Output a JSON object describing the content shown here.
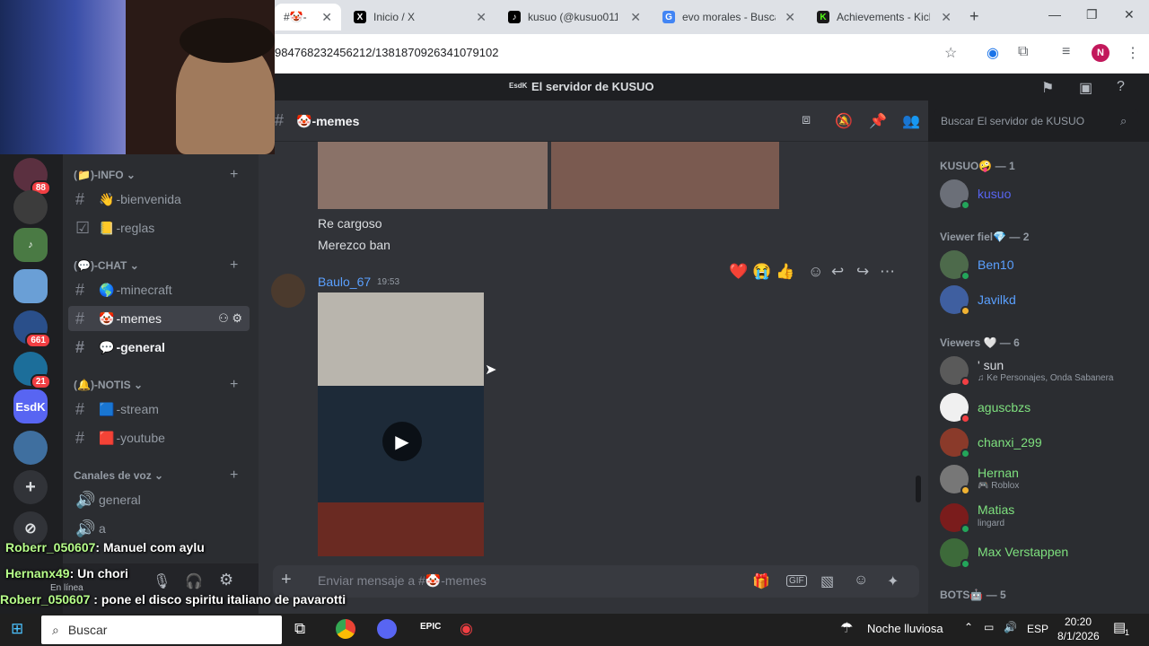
{
  "browser": {
    "tabs": [
      {
        "title": "#🤡-",
        "active": true
      },
      {
        "title": "Inicio / X"
      },
      {
        "title": "kusuo (@kusuo011) |"
      },
      {
        "title": "evo morales - Buscar"
      },
      {
        "title": "Achievements - Kick"
      }
    ],
    "new_tab": "+",
    "url": "984768232456212/1381870926341079102",
    "profile_initial": "N"
  },
  "discord": {
    "server_title": "El servidor de KUSUO",
    "server_abbrev": "EsdK",
    "rail": {
      "badges": [
        "88",
        "661",
        "21"
      ],
      "selected_server": "EsdK"
    },
    "categories": [
      {
        "label": "(📁)-INFO",
        "channels": [
          {
            "emoji": "👋",
            "name": "-bienvenida"
          },
          {
            "emoji": "📒",
            "name": "-reglas"
          }
        ]
      },
      {
        "label": "(💬)-CHAT",
        "channels": [
          {
            "emoji": "🌎",
            "name": "-minecraft"
          },
          {
            "emoji": "🤡",
            "name": "-memes"
          },
          {
            "emoji": "💬",
            "name": "-general"
          }
        ]
      },
      {
        "label": "(🔔)-NOTIS",
        "channels": [
          {
            "emoji": "🟦",
            "name": "-stream"
          },
          {
            "emoji": "🟥",
            "name": "-youtube"
          }
        ]
      }
    ],
    "voice_category": "Canales de voz",
    "voice_channels": [
      "general",
      "a"
    ],
    "channel_header": {
      "emoji": "🤡",
      "name": "-memes"
    },
    "search_placeholder": "Buscar El servidor de KUSUO",
    "messages": {
      "prev_lines": [
        "Re cargoso",
        "Merezco ban"
      ],
      "author": "Baulo_67",
      "time": "19:53",
      "play_icon": "▶"
    },
    "reactions": [
      "❤️",
      "😭",
      "👍"
    ],
    "composer_placeholder": "Enviar mensaje a #🤡-memes",
    "members": {
      "roles": [
        {
          "label": "KUSUO🤪 — 1"
        },
        {
          "label": "Viewer fiel💎 — 2"
        },
        {
          "label": "Viewers 🤍 — 6"
        },
        {
          "label": "BOTS🤖 — 5"
        }
      ],
      "list": [
        {
          "name": "kusuo",
          "color": "#5865f2",
          "status": "#23a55a"
        },
        {
          "name": "Ben10",
          "color": "#5aa0ff",
          "status": "#23a55a"
        },
        {
          "name": "Javilkd",
          "color": "#5aa0ff",
          "status": "#f0b232"
        },
        {
          "name": "' sun",
          "color": "#d7dadf",
          "sub": "♫ Ke Personajes, Onda Sabanera",
          "status": "#f23f43"
        },
        {
          "name": "aguscbzs",
          "color": "#7ee07e",
          "status": "#f23f43"
        },
        {
          "name": "chanxi_299",
          "color": "#7ee07e",
          "status": "#23a55a"
        },
        {
          "name": "Hernan",
          "color": "#7ee07e",
          "sub": "🎮 Roblox",
          "status": "#f0b232"
        },
        {
          "name": "Matias",
          "color": "#7ee07e",
          "sub": "lingard",
          "status": "#23a55a"
        },
        {
          "name": "Max Verstappen",
          "color": "#7ee07e",
          "status": "#23a55a"
        }
      ]
    },
    "user_panel": {
      "status": "En línea"
    }
  },
  "stream_chat": [
    {
      "user": "Roberr_050607",
      "text": ": Manuel com aylu"
    },
    {
      "user": "Hernanx49",
      "text": ": Un chori"
    },
    {
      "user": "Roberr_050607",
      "text": " : pone el disco spiritu italiano de pavarotti"
    }
  ],
  "taskbar": {
    "search": "Buscar",
    "weather": "Noche lluviosa",
    "lang": "ESP",
    "time": "20:20",
    "date": "8/1/2026",
    "notif": "1"
  }
}
